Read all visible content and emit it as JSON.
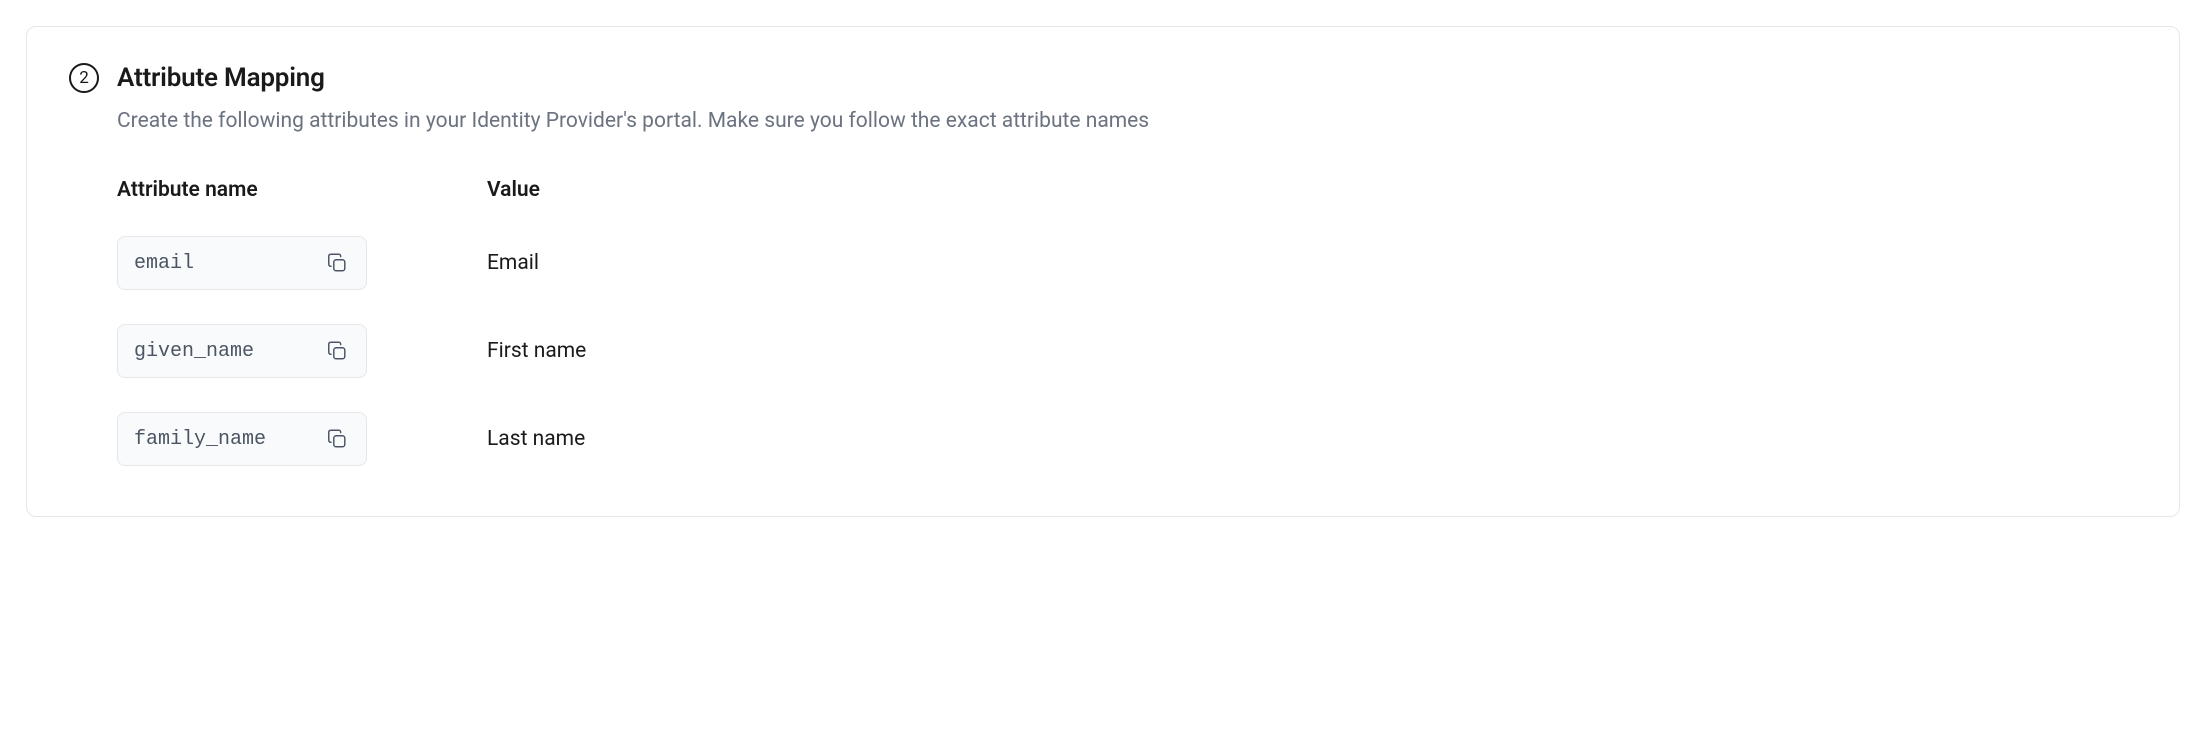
{
  "step": {
    "number": "2",
    "title": "Attribute Mapping",
    "description": "Create the following attributes in your Identity Provider's portal. Make sure you follow the exact attribute names"
  },
  "columns": {
    "name": "Attribute name",
    "value": "Value"
  },
  "attributes": [
    {
      "name": "email",
      "value": "Email"
    },
    {
      "name": "given_name",
      "value": "First name"
    },
    {
      "name": "family_name",
      "value": "Last name"
    }
  ]
}
